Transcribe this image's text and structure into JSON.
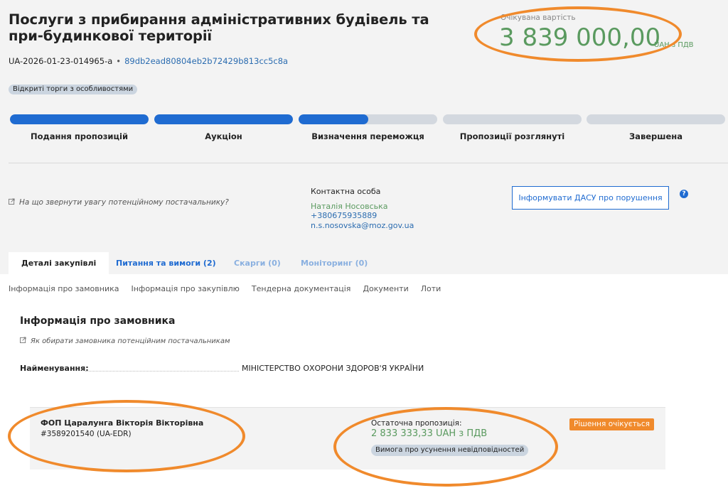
{
  "tender": {
    "title": "Послуги з прибирання адміністративних будівель та при-будинкової території",
    "id": "UA-2026-01-23-014965-a",
    "separator": "•",
    "hash": "89db2ead80804eb2b72429b813cc5c8a",
    "status_badge": "Відкриті торги з особливостями"
  },
  "price": {
    "label": "Очікувана вартість",
    "value": "3 839 000,00",
    "suffix": "UAH з ПДВ"
  },
  "stages": [
    {
      "label": "Подання пропозицій",
      "progress": 1.0
    },
    {
      "label": "Аукціон",
      "progress": 1.0
    },
    {
      "label": "Визначення переможця",
      "progress": 0.5
    },
    {
      "label": "Пропозиції розглянуті",
      "progress": 0.0
    },
    {
      "label": "Завершена",
      "progress": 0.0
    }
  ],
  "hint": {
    "icon": "external-link-icon",
    "text": "На що звернути увагу потенційному постачальнику?"
  },
  "contact": {
    "title": "Контактна особа",
    "name": "Наталія Носовська",
    "phone": "+380675935889",
    "email": "n.s.nosovska@moz.gov.ua"
  },
  "report_button": "Інформувати ДАСУ про порушення",
  "help_icon": "?",
  "tabs": [
    {
      "label": "Деталі закупівлі"
    },
    {
      "label": "Питання та вимоги (2)"
    },
    {
      "label": "Скарги (0)"
    },
    {
      "label": "Моніторинг (0)"
    }
  ],
  "subnav": [
    "Інформація про замовника",
    "Інформація про закупівлю",
    "Тендерна документація",
    "Документи",
    "Лоти"
  ],
  "customer": {
    "section_title": "Інформація про замовника",
    "how_link": "Як обирати замовника потенційним постачальникам",
    "name_label": "Найменування:",
    "name_value": "МІНІСТЕРСТВО ОХОРОНИ ЗДОРОВ'Я УКРАЇНИ"
  },
  "bid": {
    "bidder_name": "ФОП Царалунга Вікторія Вікторівна",
    "bidder_code": "#3589201540 (UA-EDR)",
    "final_label": "Остаточна пропозиція:",
    "final_value": "2 833 333,33 UAH з ПДВ",
    "requirement_badge": "Вимога про усунення невідповідностей",
    "decision_badge": "Рішення очікується"
  },
  "colors": {
    "accent": "#1f6bd1",
    "price_green": "#5a9a5f",
    "annotation_orange": "#f08a2c",
    "decision_orange": "#f08a2c"
  }
}
